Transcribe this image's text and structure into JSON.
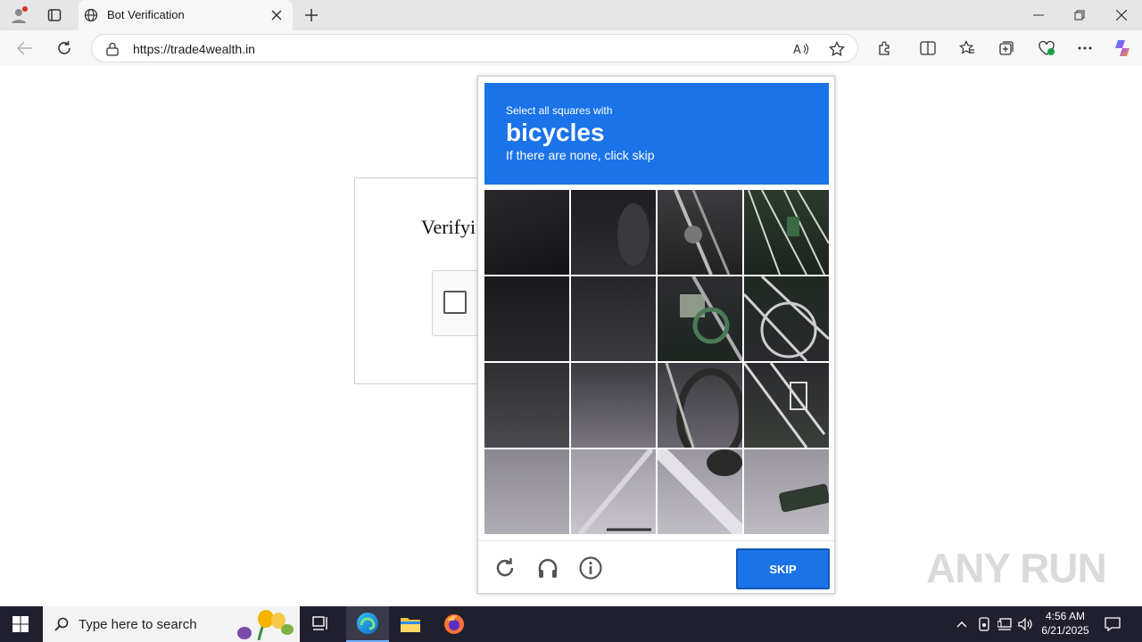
{
  "browser": {
    "tab_title": "Bot Verification",
    "url": "https://trade4wealth.in"
  },
  "page": {
    "verify_title": "Verifyi"
  },
  "captcha": {
    "instruction": "Select all squares with",
    "target": "bicycles",
    "hint": "If there are none, click skip",
    "skip_label": "SKIP"
  },
  "watermark": "ANY RUN",
  "taskbar": {
    "search_placeholder": "Type here to search",
    "time": "4:56 AM",
    "date": "6/21/2025"
  },
  "colors": {
    "accent": "#1a73e8",
    "taskbar": "#1f1f2e"
  }
}
